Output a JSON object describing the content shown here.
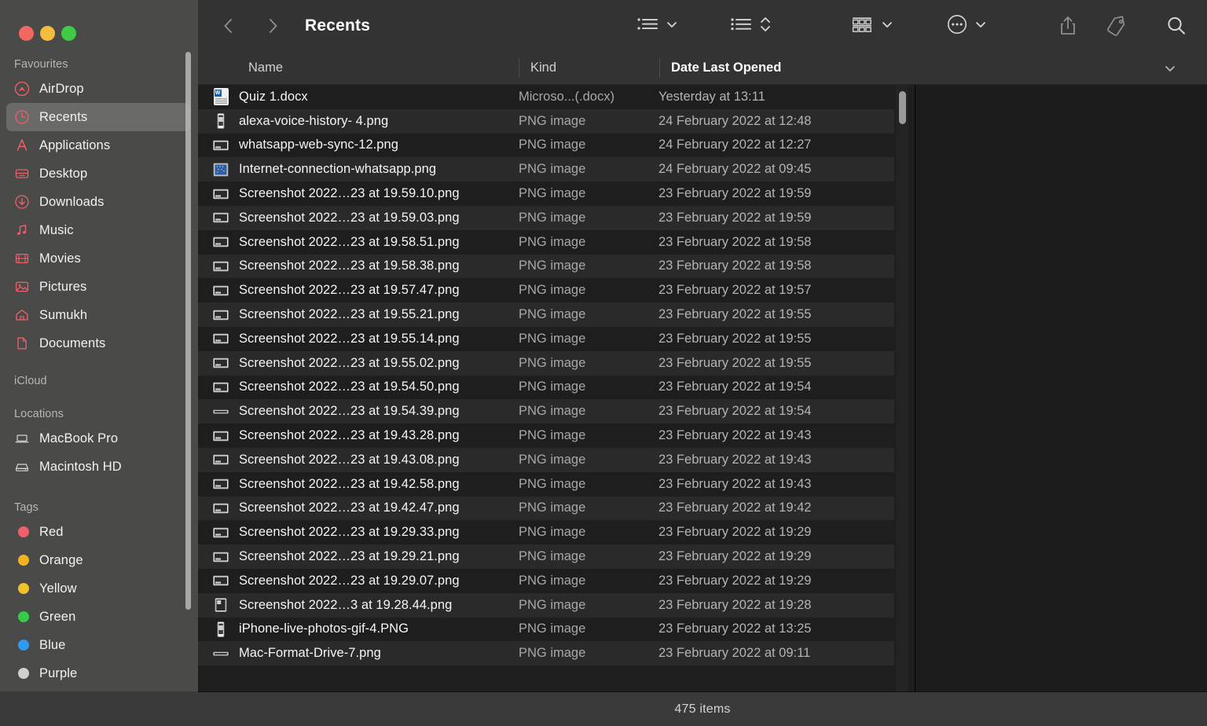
{
  "window": {
    "title": "Recents",
    "traffic_lights": [
      "close",
      "minimize",
      "maximize"
    ]
  },
  "sidebar": {
    "groups": [
      {
        "title": "Favourites",
        "items": [
          {
            "label": "AirDrop",
            "icon": "airdrop-icon",
            "active": false
          },
          {
            "label": "Recents",
            "icon": "clock-icon",
            "active": true
          },
          {
            "label": "Applications",
            "icon": "applications-icon",
            "active": false
          },
          {
            "label": "Desktop",
            "icon": "desktop-icon",
            "active": false
          },
          {
            "label": "Downloads",
            "icon": "download-icon",
            "active": false
          },
          {
            "label": "Music",
            "icon": "music-note-icon",
            "active": false
          },
          {
            "label": "Movies",
            "icon": "film-icon",
            "active": false
          },
          {
            "label": "Pictures",
            "icon": "photo-icon",
            "active": false
          },
          {
            "label": "Sumukh",
            "icon": "home-icon",
            "active": false
          },
          {
            "label": "Documents",
            "icon": "document-icon",
            "active": false
          }
        ]
      },
      {
        "title": "iCloud",
        "items": []
      },
      {
        "title": "Locations",
        "items": [
          {
            "label": "MacBook Pro",
            "icon": "laptop-icon",
            "active": false
          },
          {
            "label": "Macintosh HD",
            "icon": "harddisk-icon",
            "active": false
          }
        ]
      },
      {
        "title": "Tags",
        "items": [
          {
            "label": "Red",
            "icon": "tag-dot-icon",
            "color": "#f0606a"
          },
          {
            "label": "Orange",
            "icon": "tag-dot-icon",
            "color": "#f2b322"
          },
          {
            "label": "Yellow",
            "icon": "tag-dot-icon",
            "color": "#f2c029"
          },
          {
            "label": "Green",
            "icon": "tag-dot-icon",
            "color": "#34cc4a"
          },
          {
            "label": "Blue",
            "icon": "tag-dot-icon",
            "color": "#2f9bf0"
          },
          {
            "label": "Purple",
            "icon": "tag-dot-icon",
            "color": "#d0d0d0"
          }
        ]
      }
    ]
  },
  "toolbar": {
    "back_label": "Back",
    "forward_label": "Forward",
    "view_group_label": "Group By",
    "view_sort_label": "Sort",
    "view_arrange_label": "Item Arrangement",
    "more_label": "More",
    "share_label": "Share",
    "tag_label": "Tags",
    "search_label": "Search"
  },
  "columns": [
    {
      "key": "name",
      "label": "Name",
      "sorted": false
    },
    {
      "key": "kind",
      "label": "Kind",
      "sorted": false
    },
    {
      "key": "date",
      "label": "Date Last Opened",
      "sorted": true
    }
  ],
  "files": [
    {
      "name": "Quiz 1.docx",
      "kind": "Microso...(.docx)",
      "date": "Yesterday at 13:11",
      "icon": "word-doc-icon"
    },
    {
      "name": "alexa-voice-history- 4.png",
      "kind": "PNG image",
      "date": "24 February 2022 at 12:48",
      "icon": "png-phone-icon"
    },
    {
      "name": "whatsapp-web-sync-12.png",
      "kind": "PNG image",
      "date": "24 February 2022 at 12:27",
      "icon": "png-window-icon"
    },
    {
      "name": "Internet-connection-whatsapp.png",
      "kind": "PNG image",
      "date": "24 February 2022 at 09:45",
      "icon": "png-blue-icon"
    },
    {
      "name": "Screenshot 2022…23 at 19.59.10.png",
      "kind": "PNG image",
      "date": "23 February 2022 at 19:59",
      "icon": "png-window-icon"
    },
    {
      "name": "Screenshot 2022…23 at 19.59.03.png",
      "kind": "PNG image",
      "date": "23 February 2022 at 19:59",
      "icon": "png-window-icon"
    },
    {
      "name": "Screenshot 2022…23 at 19.58.51.png",
      "kind": "PNG image",
      "date": "23 February 2022 at 19:58",
      "icon": "png-window-icon"
    },
    {
      "name": "Screenshot 2022…23 at 19.58.38.png",
      "kind": "PNG image",
      "date": "23 February 2022 at 19:58",
      "icon": "png-window-icon"
    },
    {
      "name": "Screenshot 2022…23 at 19.57.47.png",
      "kind": "PNG image",
      "date": "23 February 2022 at 19:57",
      "icon": "png-window-icon"
    },
    {
      "name": "Screenshot 2022…23 at 19.55.21.png",
      "kind": "PNG image",
      "date": "23 February 2022 at 19:55",
      "icon": "png-window-icon"
    },
    {
      "name": "Screenshot 2022…23 at 19.55.14.png",
      "kind": "PNG image",
      "date": "23 February 2022 at 19:55",
      "icon": "png-window-icon"
    },
    {
      "name": "Screenshot 2022…23 at 19.55.02.png",
      "kind": "PNG image",
      "date": "23 February 2022 at 19:55",
      "icon": "png-window-icon"
    },
    {
      "name": "Screenshot 2022…23 at 19.54.50.png",
      "kind": "PNG image",
      "date": "23 February 2022 at 19:54",
      "icon": "png-window-icon"
    },
    {
      "name": "Screenshot 2022…23 at 19.54.39.png",
      "kind": "PNG image",
      "date": "23 February 2022 at 19:54",
      "icon": "png-bar-icon"
    },
    {
      "name": "Screenshot 2022…23 at 19.43.28.png",
      "kind": "PNG image",
      "date": "23 February 2022 at 19:43",
      "icon": "png-window-icon"
    },
    {
      "name": "Screenshot 2022…23 at 19.43.08.png",
      "kind": "PNG image",
      "date": "23 February 2022 at 19:43",
      "icon": "png-window-icon"
    },
    {
      "name": "Screenshot 2022…23 at 19.42.58.png",
      "kind": "PNG image",
      "date": "23 February 2022 at 19:43",
      "icon": "png-window-icon"
    },
    {
      "name": "Screenshot 2022…23 at 19.42.47.png",
      "kind": "PNG image",
      "date": "23 February 2022 at 19:42",
      "icon": "png-window-icon"
    },
    {
      "name": "Screenshot 2022…23 at 19.29.33.png",
      "kind": "PNG image",
      "date": "23 February 2022 at 19:29",
      "icon": "png-window-icon"
    },
    {
      "name": "Screenshot 2022…23 at 19.29.21.png",
      "kind": "PNG image",
      "date": "23 February 2022 at 19:29",
      "icon": "png-window-icon"
    },
    {
      "name": "Screenshot 2022…23 at 19.29.07.png",
      "kind": "PNG image",
      "date": "23 February 2022 at 19:29",
      "icon": "png-window-icon"
    },
    {
      "name": "Screenshot 2022…3 at 19.28.44.png",
      "kind": "PNG image",
      "date": "23 February 2022 at 19:28",
      "icon": "png-tall-icon"
    },
    {
      "name": "iPhone-live-photos-gif-4.PNG",
      "kind": "PNG image",
      "date": "23 February 2022 at 13:25",
      "icon": "png-phone-icon"
    },
    {
      "name": "Mac-Format-Drive-7.png",
      "kind": "PNG image",
      "date": "23 February 2022 at 09:11",
      "icon": "png-bar-icon"
    }
  ],
  "status": {
    "items_text": "475 items"
  },
  "colors": {
    "sidebar_bg": "#4a4a48",
    "toolbar_bg": "#333333",
    "list_bg": "#1e1e1e",
    "row_alt_bg": "#2a2a2a",
    "status_bg": "#3a3a3a",
    "accent_red": "#f0606a",
    "text_primary": "#f5f5f5",
    "text_secondary": "#a8a8a8"
  }
}
